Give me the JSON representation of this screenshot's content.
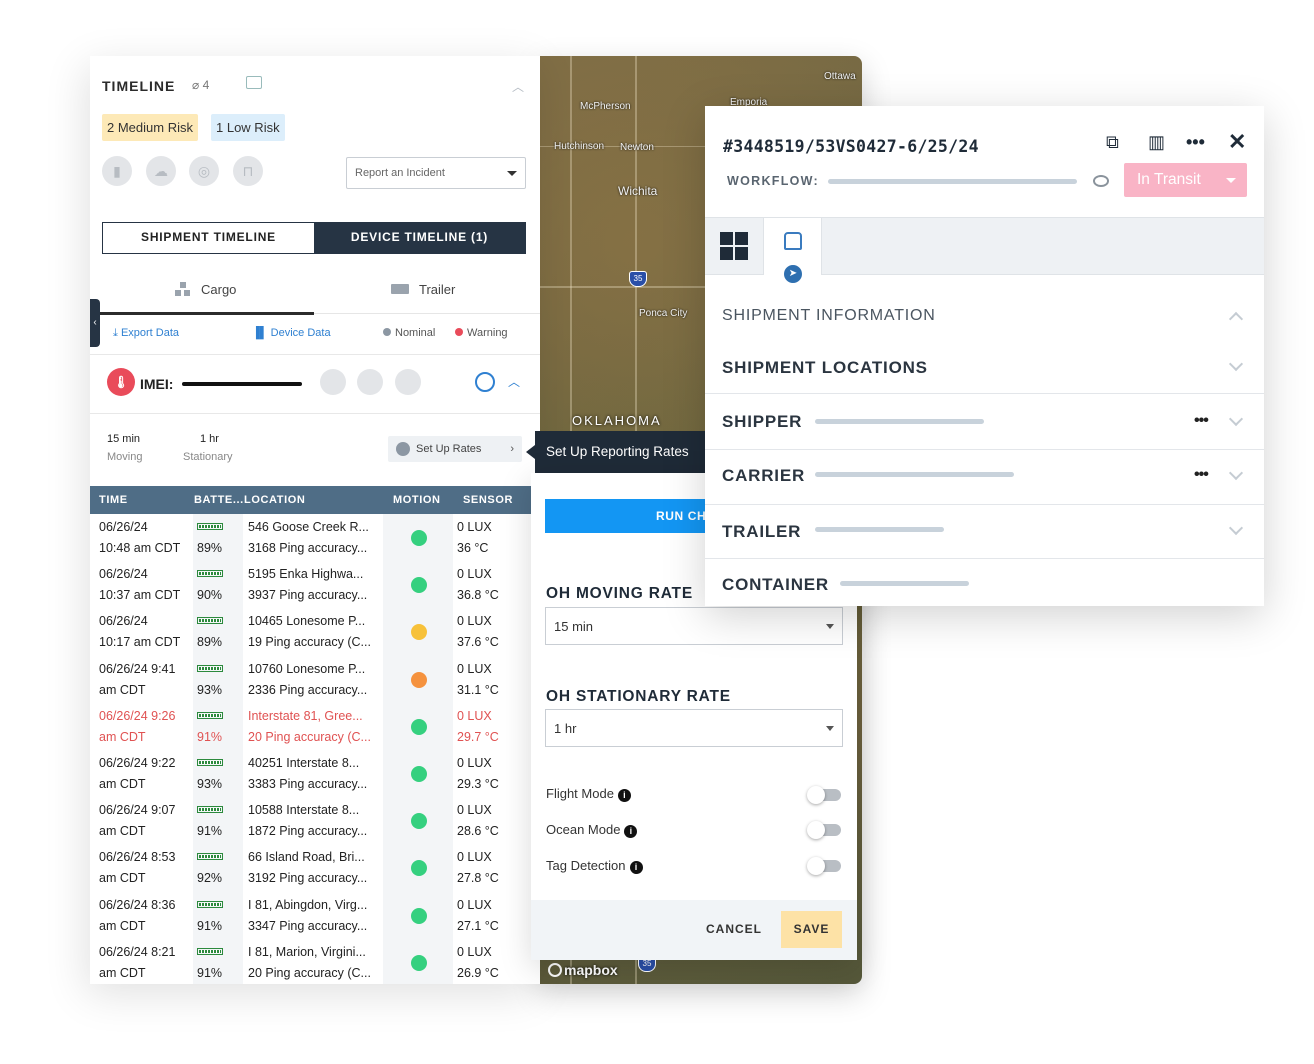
{
  "timeline": {
    "title": "TIMELINE",
    "attachments_count": "4",
    "risks": {
      "medium": "2 Medium Risk",
      "low": "1 Low Risk"
    },
    "incident_placeholder": "Report an Incident",
    "segmented": {
      "shipment": "SHIPMENT TIMELINE",
      "device": "DEVICE TIMELINE (1)"
    },
    "subtabs": {
      "cargo": "Cargo",
      "trailer": "Trailer"
    },
    "links": {
      "export": "Export Data",
      "device": "Device Data"
    },
    "legend": {
      "nominal": "Nominal",
      "warning": "Warning",
      "nominal_color": "#8c97a3",
      "warning_color": "#e94b5a"
    },
    "imei_label": "IMEI:",
    "rates": {
      "moving_value": "15 min",
      "moving_label": "Moving",
      "stationary_value": "1 hr",
      "stationary_label": "Stationary",
      "setup_label": "Set Up Rates"
    },
    "table": {
      "headers": {
        "time": "TIME",
        "battery": "BATTE...",
        "location": "LOCATION",
        "motion": "MOTION",
        "sensor": "SENSOR"
      },
      "rows": [
        {
          "time1": "06/26/24",
          "time2": "10:48 am CDT",
          "batt": "89%",
          "loc1": "546 Goose Creek R...",
          "loc2": "3168 Ping accuracy...",
          "motion": "#35d07f",
          "sen1": "0 LUX",
          "sen2": "36 °C",
          "alert": false
        },
        {
          "time1": "06/26/24",
          "time2": "10:37 am CDT",
          "batt": "90%",
          "loc1": "5195 Enka Highwa...",
          "loc2": "3937 Ping accuracy...",
          "motion": "#35d07f",
          "sen1": "0 LUX",
          "sen2": "36.8 °C",
          "alert": false
        },
        {
          "time1": "06/26/24",
          "time2": "10:17 am CDT",
          "batt": "89%",
          "loc1": "10465 Lonesome P...",
          "loc2": "19 Ping accuracy (C...",
          "motion": "#f7c13a",
          "sen1": "0 LUX",
          "sen2": "37.6 °C",
          "alert": false
        },
        {
          "time1": "06/26/24 9:41",
          "time2": "am CDT",
          "batt": "93%",
          "loc1": "10760 Lonesome P...",
          "loc2": "2336 Ping accuracy...",
          "motion": "#f5923e",
          "sen1": "0 LUX",
          "sen2": "31.1 °C",
          "alert": false
        },
        {
          "time1": "06/26/24 9:26",
          "time2": "am CDT",
          "batt": "91%",
          "loc1": "Interstate 81, Gree...",
          "loc2": "20 Ping accuracy (C...",
          "motion": "#35d07f",
          "sen1": "0 LUX",
          "sen2": "29.7 °C",
          "alert": true
        },
        {
          "time1": "06/26/24 9:22",
          "time2": "am CDT",
          "batt": "93%",
          "loc1": "40251 Interstate 8...",
          "loc2": "3383 Ping accuracy...",
          "motion": "#35d07f",
          "sen1": "0 LUX",
          "sen2": "29.3 °C",
          "alert": false
        },
        {
          "time1": "06/26/24 9:07",
          "time2": "am CDT",
          "batt": "91%",
          "loc1": "10588 Interstate 8...",
          "loc2": "1872 Ping accuracy...",
          "motion": "#35d07f",
          "sen1": "0 LUX",
          "sen2": "28.6 °C",
          "alert": false
        },
        {
          "time1": "06/26/24 8:53",
          "time2": "am CDT",
          "batt": "92%",
          "loc1": "66 Island Road, Bri...",
          "loc2": "3192 Ping accuracy...",
          "motion": "#35d07f",
          "sen1": "0 LUX",
          "sen2": "27.8 °C",
          "alert": false
        },
        {
          "time1": "06/26/24 8:36",
          "time2": "am CDT",
          "batt": "91%",
          "loc1": "I 81, Abingdon, Virg...",
          "loc2": "3347 Ping accuracy...",
          "motion": "#35d07f",
          "sen1": "0 LUX",
          "sen2": "27.1 °C",
          "alert": false
        },
        {
          "time1": "06/26/24 8:21",
          "time2": "am CDT",
          "batt": "91%",
          "loc1": "I 81, Marion, Virgini...",
          "loc2": "20 Ping accuracy (C...",
          "motion": "#35d07f",
          "sen1": "0 LUX",
          "sen2": "26.9 °C",
          "alert": false
        }
      ]
    }
  },
  "map": {
    "cities": [
      "Ottawa",
      "McPherson",
      "Emporia",
      "Hutchinson",
      "Newton",
      "Wichita",
      "Ponca City"
    ],
    "state": "OKLAHOMA",
    "shield": "35",
    "shield_bottom": "35",
    "attribution": "mapbox"
  },
  "tooltip": "Set Up Reporting Rates",
  "rates_panel": {
    "run_label": "RUN CH",
    "moving_heading": "OH MOVING RATE",
    "moving_value": "15 min",
    "stationary_heading": "OH STATIONARY RATE",
    "stationary_value": "1 hr",
    "toggles": {
      "flight": "Flight Mode",
      "ocean": "Ocean Mode",
      "tag": "Tag Detection"
    },
    "cancel": "CANCEL",
    "save": "SAVE"
  },
  "detail": {
    "title": "#3448519/53VS0427-6/25/24",
    "workflow_label": "WORKFLOW:",
    "status": "In Transit",
    "status_color": "#f9b4c6",
    "sections": {
      "info": "SHIPMENT INFORMATION",
      "locations": "SHIPMENT LOCATIONS",
      "shipper": "SHIPPER",
      "carrier": "CARRIER",
      "trailer": "TRAILER",
      "container": "CONTAINER"
    }
  }
}
